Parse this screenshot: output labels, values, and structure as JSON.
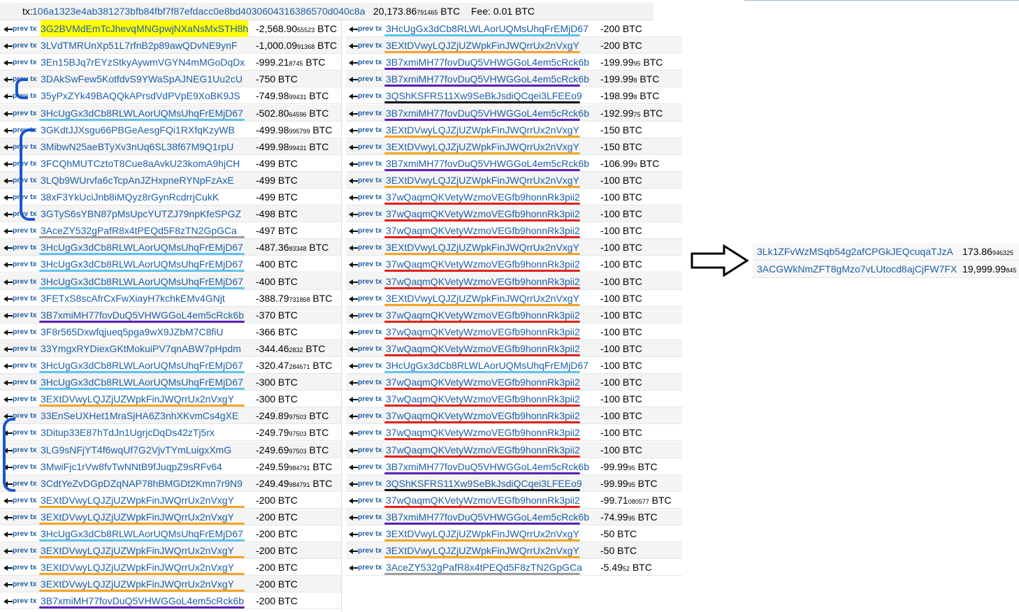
{
  "tx": {
    "label": "tx:",
    "hash": "106a1323e4ab381273bfb84fbf7f87efdacc0e8bd4030604316386570d040c8a",
    "amount_main": "20,173.86",
    "amount_small": "791465",
    "unit": "BTC",
    "fee": "Fee: 0.01 BTC"
  },
  "prev_label": "prev tx",
  "colors": {
    "link": "#1d5fa8",
    "yellow": "#ffff00",
    "lightblue": "#5fc4f2",
    "orange": "#f5a623",
    "purple": "#5b21b6",
    "black": "#111111",
    "red": "#e0241b",
    "gray": "#9e9e9e",
    "blue": "#1a56c9"
  },
  "inputs_left": [
    {
      "addr": "3G2BVMdEmTcJhevqMNGpwjNXaNsMxSTH8h",
      "amt": "-2,568.90",
      "small": "55523",
      "unit": "BTC",
      "mark": "yellow"
    },
    {
      "addr": "3LVdTMRUnXp51L7rfnB2p89awQDvNE9ynF",
      "amt": "-1,000.09",
      "small": "91368",
      "unit": "BTC",
      "mark": ""
    },
    {
      "addr": "3En15BJq7rEYzStkyAywmVGYN4mMGoDqDx",
      "amt": "-999.21",
      "small": "8745",
      "unit": "BTC",
      "mark": ""
    },
    {
      "addr": "3DAkSwFew5KotfdvS9YWaSpAJNEG1Uu2cU",
      "amt": "-750",
      "small": "",
      "unit": "BTC",
      "mark": ""
    },
    {
      "addr": "35yPxZYk49BAQQkAPrsdVdPVpE9XoBK9JS",
      "amt": "-749.98",
      "small": "99431",
      "unit": "BTC",
      "mark": ""
    },
    {
      "addr": "3HcUgGx3dCb8RLWLAorUQMsUhqFrEMjD67",
      "amt": "-502.80",
      "small": "64596",
      "unit": "BTC",
      "mark": "lightblue"
    },
    {
      "addr": "3GKdtJJXsgu66PBGeAesgFQi1RXfqKzyWB",
      "amt": "-499.98",
      "small": "995799",
      "unit": "BTC",
      "mark": ""
    },
    {
      "addr": "3MibwN25aeBTyXv3nUq6SL38f67M9Q1rpU",
      "amt": "-499.98",
      "small": "99431",
      "unit": "BTC",
      "mark": ""
    },
    {
      "addr": "3FCQhMUTCztoT8Cue8aAvkU23komA9hjCH",
      "amt": "-499",
      "small": "",
      "unit": "BTC",
      "mark": ""
    },
    {
      "addr": "3LQb9WUrvfa6cTcpAnJZHxpneRYNpFzAxE",
      "amt": "-499",
      "small": "",
      "unit": "BTC",
      "mark": ""
    },
    {
      "addr": "38xF3YkUciJnb8iMQyz8rGynRcdrrjCukK",
      "amt": "-499",
      "small": "",
      "unit": "BTC",
      "mark": ""
    },
    {
      "addr": "3GTyS6sYBN87pMsUpcYUTZJ79npKfeSPGZ",
      "amt": "-498",
      "small": "",
      "unit": "BTC",
      "mark": ""
    },
    {
      "addr": "3AceZY532gPafR8x4tPEQd5F8zTN2GpGCa",
      "amt": "-497",
      "small": "",
      "unit": "BTC",
      "mark": "gray"
    },
    {
      "addr": "3HcUgGx3dCb8RLWLAorUQMsUhqFrEMjD67",
      "amt": "-487.36",
      "small": "83348",
      "unit": "BTC",
      "mark": "lightblue"
    },
    {
      "addr": "3HcUgGx3dCb8RLWLAorUQMsUhqFrEMjD67",
      "amt": "-400",
      "small": "",
      "unit": "BTC",
      "mark": "lightblue"
    },
    {
      "addr": "3HcUgGx3dCb8RLWLAorUQMsUhqFrEMjD67",
      "amt": "-400",
      "small": "",
      "unit": "BTC",
      "mark": "lightblue"
    },
    {
      "addr": "3FETxS8scAfrCxFwXiayH7kchkEMv4GNjt",
      "amt": "-388.79",
      "small": "731868",
      "unit": "BTC",
      "mark": ""
    },
    {
      "addr": "3B7xmiMH77fovDuQ5VHWGGoL4em5cRck6b",
      "amt": "-370",
      "small": "",
      "unit": "BTC",
      "mark": "purple"
    },
    {
      "addr": "3F8r565Dxwfqjueq5pga9wX9JZbM7C8fiU",
      "amt": "-366",
      "small": "",
      "unit": "BTC",
      "mark": ""
    },
    {
      "addr": "33YmgxRYDiexGKtMokuiPV7qnABW7pHpdm",
      "amt": "-344.46",
      "small": "2832",
      "unit": "BTC",
      "mark": ""
    },
    {
      "addr": "3HcUgGx3dCb8RLWLAorUQMsUhqFrEMjD67",
      "amt": "-320.47",
      "small": "284671",
      "unit": "BTC",
      "mark": "lightblue"
    },
    {
      "addr": "3HcUgGx3dCb8RLWLAorUQMsUhqFrEMjD67",
      "amt": "-300",
      "small": "",
      "unit": "BTC",
      "mark": "lightblue"
    },
    {
      "addr": "3EXtDVwyLQJZjUZWpkFinJWQrrUx2nVxgY",
      "amt": "-300",
      "small": "",
      "unit": "BTC",
      "mark": "orange"
    },
    {
      "addr": "33EnSeUXHet1MraSjHA6Z3nhXKvmCs4gXE",
      "amt": "-249.89",
      "small": "97503",
      "unit": "BTC",
      "mark": ""
    },
    {
      "addr": "3Ditup33E87hTdJn1UgrjcDqDs42zTj5rx",
      "amt": "-249.79",
      "small": "97503",
      "unit": "BTC",
      "mark": ""
    },
    {
      "addr": "3LG9sNFjYT4f6wqUf7G2VjvTYmLuigxXmG",
      "amt": "-249.69",
      "small": "97503",
      "unit": "BTC",
      "mark": ""
    },
    {
      "addr": "3MwiFjc1rVw8fvTwNNtB9fJuqpZ9sRFv64",
      "amt": "-249.59",
      "small": "984791",
      "unit": "BTC",
      "mark": ""
    },
    {
      "addr": "3CdtYeZvDGpDZqNAP78hBMGDt2Kmn7r9N9",
      "amt": "-249.49",
      "small": "984791",
      "unit": "BTC",
      "mark": ""
    },
    {
      "addr": "3EXtDVwyLQJZjUZWpkFinJWQrrUx2nVxgY",
      "amt": "-200",
      "small": "",
      "unit": "BTC",
      "mark": "orange"
    },
    {
      "addr": "3EXtDVwyLQJZjUZWpkFinJWQrrUx2nVxgY",
      "amt": "-200",
      "small": "",
      "unit": "BTC",
      "mark": "orange"
    },
    {
      "addr": "3HcUgGx3dCb8RLWLAorUQMsUhqFrEMjD67",
      "amt": "-200",
      "small": "",
      "unit": "BTC",
      "mark": "lightblue"
    },
    {
      "addr": "3EXtDVwyLQJZjUZWpkFinJWQrrUx2nVxgY",
      "amt": "-200",
      "small": "",
      "unit": "BTC",
      "mark": "orange"
    },
    {
      "addr": "3EXtDVwyLQJZjUZWpkFinJWQrrUx2nVxgY",
      "amt": "-200",
      "small": "",
      "unit": "BTC",
      "mark": "orange"
    },
    {
      "addr": "3EXtDVwyLQJZjUZWpkFinJWQrrUx2nVxgY",
      "amt": "-200",
      "small": "",
      "unit": "BTC",
      "mark": "orange"
    },
    {
      "addr": "3B7xmiMH77fovDuQ5VHWGGoL4em5cRck6b",
      "amt": "-200",
      "small": "",
      "unit": "BTC",
      "mark": "purple"
    }
  ],
  "inputs_right": [
    {
      "addr": "3HcUgGx3dCb8RLWLAorUQMsUhqFrEMjD67",
      "amt": "-200",
      "small": "",
      "unit": "BTC",
      "mark": "lightblue"
    },
    {
      "addr": "3EXtDVwyLQJZjUZWpkFinJWQrrUx2nVxgY",
      "amt": "-200",
      "small": "",
      "unit": "BTC",
      "mark": "orange"
    },
    {
      "addr": "3B7xmiMH77fovDuQ5VHWGGoL4em5cRck6b",
      "amt": "-199.99",
      "small": "95",
      "unit": "BTC",
      "mark": "purple"
    },
    {
      "addr": "3B7xmiMH77fovDuQ5VHWGGoL4em5cRck6b",
      "amt": "-199.99",
      "small": "8",
      "unit": "BTC",
      "mark": "purple"
    },
    {
      "addr": "3QShKSFRS11Xw9SeBkJsdiQCqei3LFEEo9",
      "amt": "-198.99",
      "small": "8",
      "unit": "BTC",
      "mark": "black"
    },
    {
      "addr": "3B7xmiMH77fovDuQ5VHWGGoL4em5cRck6b",
      "amt": "-192.99",
      "small": "75",
      "unit": "BTC",
      "mark": "purple"
    },
    {
      "addr": "3EXtDVwyLQJZjUZWpkFinJWQrrUx2nVxgY",
      "amt": "-150",
      "small": "",
      "unit": "BTC",
      "mark": "orange"
    },
    {
      "addr": "3EXtDVwyLQJZjUZWpkFinJWQrrUx2nVxgY",
      "amt": "-150",
      "small": "",
      "unit": "BTC",
      "mark": "orange"
    },
    {
      "addr": "3B7xmiMH77fovDuQ5VHWGGoL4em5cRck6b",
      "amt": "-106.99",
      "small": "9",
      "unit": "BTC",
      "mark": "purple"
    },
    {
      "addr": "3EXtDVwyLQJZjUZWpkFinJWQrrUx2nVxgY",
      "amt": "-100",
      "small": "",
      "unit": "BTC",
      "mark": "orange"
    },
    {
      "addr": "37wQaqmQKVetyWzmoVEGfb9honnRk3pii2",
      "amt": "-100",
      "small": "",
      "unit": "BTC",
      "mark": "red"
    },
    {
      "addr": "37wQaqmQKVetyWzmoVEGfb9honnRk3pii2",
      "amt": "-100",
      "small": "",
      "unit": "BTC",
      "mark": "red"
    },
    {
      "addr": "37wQaqmQKVetyWzmoVEGfb9honnRk3pii2",
      "amt": "-100",
      "small": "",
      "unit": "BTC",
      "mark": "red"
    },
    {
      "addr": "3EXtDVwyLQJZjUZWpkFinJWQrrUx2nVxgY",
      "amt": "-100",
      "small": "",
      "unit": "BTC",
      "mark": "orange"
    },
    {
      "addr": "37wQaqmQKVetyWzmoVEGfb9honnRk3pii2",
      "amt": "-100",
      "small": "",
      "unit": "BTC",
      "mark": "red"
    },
    {
      "addr": "37wQaqmQKVetyWzmoVEGfb9honnRk3pii2",
      "amt": "-100",
      "small": "",
      "unit": "BTC",
      "mark": "red"
    },
    {
      "addr": "3EXtDVwyLQJZjUZWpkFinJWQrrUx2nVxgY",
      "amt": "-100",
      "small": "",
      "unit": "BTC",
      "mark": "orange"
    },
    {
      "addr": "37wQaqmQKVetyWzmoVEGfb9honnRk3pii2",
      "amt": "-100",
      "small": "",
      "unit": "BTC",
      "mark": "red"
    },
    {
      "addr": "37wQaqmQKVetyWzmoVEGfb9honnRk3pii2",
      "amt": "-100",
      "small": "",
      "unit": "BTC",
      "mark": "red"
    },
    {
      "addr": "37wQaqmQKVetyWzmoVEGfb9honnRk3pii2",
      "amt": "-100",
      "small": "",
      "unit": "BTC",
      "mark": "red"
    },
    {
      "addr": "3HcUgGx3dCb8RLWLAorUQMsUhqFrEMjD67",
      "amt": "-100",
      "small": "",
      "unit": "BTC",
      "mark": "lightblue"
    },
    {
      "addr": "37wQaqmQKVetyWzmoVEGfb9honnRk3pii2",
      "amt": "-100",
      "small": "",
      "unit": "BTC",
      "mark": "red"
    },
    {
      "addr": "37wQaqmQKVetyWzmoVEGfb9honnRk3pii2",
      "amt": "-100",
      "small": "",
      "unit": "BTC",
      "mark": "red"
    },
    {
      "addr": "37wQaqmQKVetyWzmoVEGfb9honnRk3pii2",
      "amt": "-100",
      "small": "",
      "unit": "BTC",
      "mark": "red"
    },
    {
      "addr": "37wQaqmQKVetyWzmoVEGfb9honnRk3pii2",
      "amt": "-100",
      "small": "",
      "unit": "BTC",
      "mark": "red"
    },
    {
      "addr": "37wQaqmQKVetyWzmoVEGfb9honnRk3pii2",
      "amt": "-100",
      "small": "",
      "unit": "BTC",
      "mark": "red"
    },
    {
      "addr": "3B7xmiMH77fovDuQ5VHWGGoL4em5cRck6b",
      "amt": "-99.99",
      "small": "95",
      "unit": "BTC",
      "mark": "purple"
    },
    {
      "addr": "3QShKSFRS11Xw9SeBkJsdiQCqei3LFEEo9",
      "amt": "-99.99",
      "small": "95",
      "unit": "BTC",
      "mark": "black"
    },
    {
      "addr": "37wQaqmQKVetyWzmoVEGfb9honnRk3pii2",
      "amt": "-99.71",
      "small": "080577",
      "unit": "BTC",
      "mark": "red"
    },
    {
      "addr": "3B7xmiMH77fovDuQ5VHWGGoL4em5cRck6b",
      "amt": "-74.99",
      "small": "95",
      "unit": "BTC",
      "mark": "purple"
    },
    {
      "addr": "3EXtDVwyLQJZjUZWpkFinJWQrrUx2nVxgY",
      "amt": "-50",
      "small": "",
      "unit": "BTC",
      "mark": "orange"
    },
    {
      "addr": "3EXtDVwyLQJZjUZWpkFinJWQrrUx2nVxgY",
      "amt": "-50",
      "small": "",
      "unit": "BTC",
      "mark": "orange"
    },
    {
      "addr": "3AceZY532gPafR8x4tPEQd5F8zTN2GpGCa",
      "amt": "-5.49",
      "small": "52",
      "unit": "BTC",
      "mark": "gray"
    }
  ],
  "outputs": [
    {
      "addr": "3Lk1ZFvWzMSqb54g2afCPGkJEQcuqaTJzA",
      "amt": "173.86",
      "small": "946325"
    },
    {
      "addr": "3ACGWkNmZFT8gMzo7vLUtocd8ajCjFW7FX",
      "amt": "19,999.99",
      "small": "845"
    }
  ],
  "icons": {
    "prev_arrow": "left-arrow-icon",
    "flow_arrow": "right-arrow-icon"
  }
}
